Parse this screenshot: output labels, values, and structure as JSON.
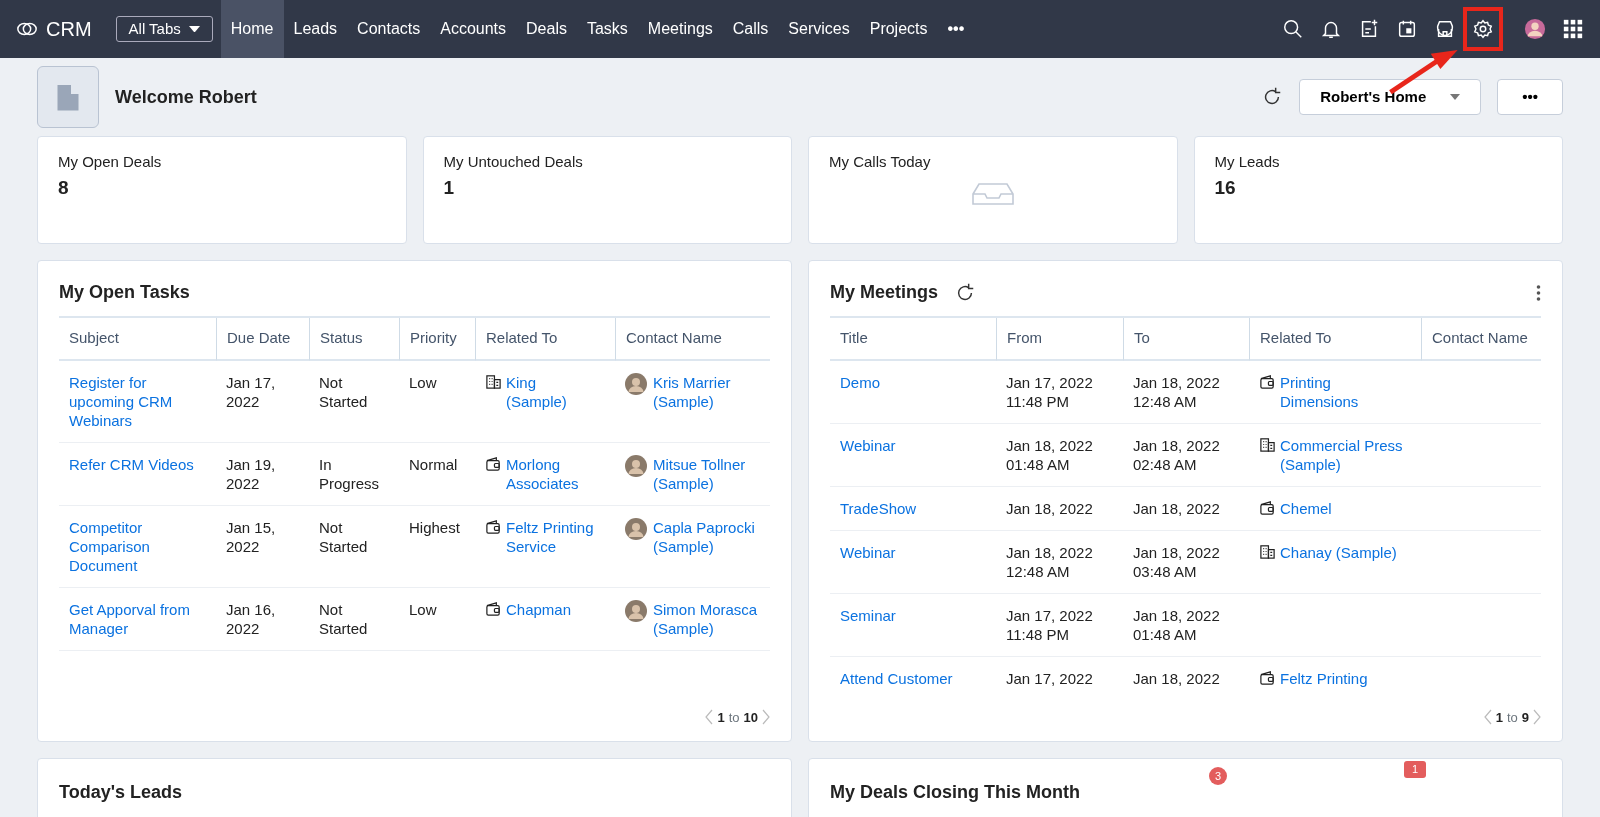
{
  "nav": {
    "logo_text": "CRM",
    "all_tabs": "All Tabs",
    "more": "•••",
    "tabs": [
      {
        "label": "Home",
        "selected": true
      },
      {
        "label": "Leads",
        "selected": false
      },
      {
        "label": "Contacts",
        "selected": false
      },
      {
        "label": "Accounts",
        "selected": false
      },
      {
        "label": "Deals",
        "selected": false
      },
      {
        "label": "Tasks",
        "selected": false
      },
      {
        "label": "Meetings",
        "selected": false
      },
      {
        "label": "Calls",
        "selected": false
      },
      {
        "label": "Services",
        "selected": false
      },
      {
        "label": "Projects",
        "selected": false
      }
    ]
  },
  "header": {
    "welcome": "Welcome Robert",
    "view": "Robert's Home",
    "more": "•••"
  },
  "kpis": [
    {
      "title": "My Open Deals",
      "kind": "value",
      "value": "8"
    },
    {
      "title": "My Untouched Deals",
      "kind": "value",
      "value": "1"
    },
    {
      "title": "My Calls Today",
      "kind": "empty"
    },
    {
      "title": "My Leads",
      "kind": "value",
      "value": "16"
    }
  ],
  "tasks": {
    "title": "My Open Tasks",
    "columns": [
      "Subject",
      "Due Date",
      "Status",
      "Priority",
      "Related To",
      "Contact Name"
    ],
    "rows": [
      {
        "subject": "Register for upcoming CRM Webinars",
        "due": "Jan 17, 2022",
        "status": "Not Started",
        "priority": "Low",
        "related": {
          "kind": "account",
          "text": "King (Sample)"
        },
        "contact": "Kris Marrier (Sample)"
      },
      {
        "subject": "Refer CRM Videos",
        "due": "Jan 19, 2022",
        "status": "In Progress",
        "priority": "Normal",
        "related": {
          "kind": "deal",
          "text": "Morlong Associates"
        },
        "contact": "Mitsue Tollner (Sample)"
      },
      {
        "subject": "Competitor Comparison Document",
        "due": "Jan 15, 2022",
        "status": "Not Started",
        "priority": "Highest",
        "related": {
          "kind": "deal",
          "text": "Feltz Printing Service"
        },
        "contact": "Capla Paprocki (Sample)"
      },
      {
        "subject": "Get Apporval from Manager",
        "due": "Jan 16, 2022",
        "status": "Not Started",
        "priority": "Low",
        "related": {
          "kind": "deal",
          "text": "Chapman"
        },
        "contact": "Simon Morasca (Sample)"
      }
    ],
    "pager": {
      "start": "1",
      "sep": "to",
      "end": "10"
    }
  },
  "meetings": {
    "title": "My Meetings",
    "columns": [
      "Title",
      "From",
      "To",
      "Related To",
      "Contact Name"
    ],
    "rows": [
      {
        "title": "Demo",
        "from": "Jan 17, 2022 11:48 PM",
        "to": "Jan 18, 2022 12:48 AM",
        "related": {
          "kind": "deal",
          "text": "Printing Dimensions"
        }
      },
      {
        "title": "Webinar",
        "from": "Jan 18, 2022 01:48 AM",
        "to": "Jan 18, 2022 02:48 AM",
        "related": {
          "kind": "account",
          "text": "Commercial Press (Sample)"
        }
      },
      {
        "title": "TradeShow",
        "from": "Jan 18, 2022",
        "to": "Jan 18, 2022",
        "related": {
          "kind": "deal",
          "text": "Chemel"
        }
      },
      {
        "title": "Webinar",
        "from": "Jan 18, 2022 12:48 AM",
        "to": "Jan 18, 2022 03:48 AM",
        "related": {
          "kind": "account",
          "text": "Chanay (Sample)"
        }
      },
      {
        "title": "Seminar",
        "from": "Jan 17, 2022 11:48 PM",
        "to": "Jan 18, 2022 01:48 AM"
      },
      {
        "title": "Attend Customer",
        "from": "Jan 17, 2022",
        "to": "Jan 18, 2022",
        "related": {
          "kind": "deal",
          "text": "Feltz Printing"
        }
      }
    ],
    "pager": {
      "start": "1",
      "sep": "to",
      "end": "9"
    }
  },
  "bottom": [
    {
      "title": "Today's Leads"
    },
    {
      "title": "My Deals Closing This Month",
      "badges": [
        {
          "kind": "dot",
          "text": "3"
        },
        {
          "kind": "tag",
          "text": "1"
        }
      ]
    }
  ]
}
